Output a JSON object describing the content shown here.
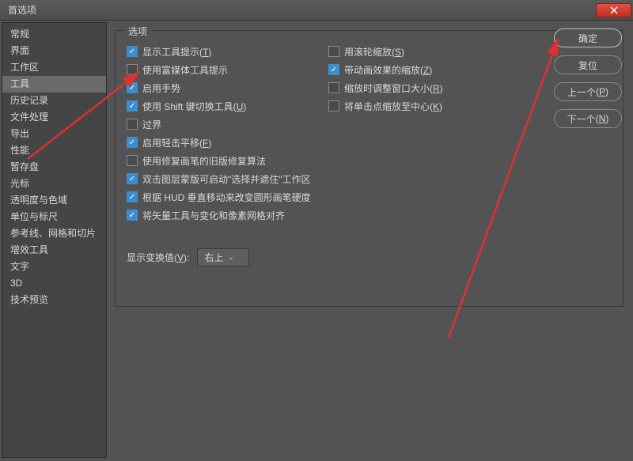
{
  "window": {
    "title": "首选项"
  },
  "sidebar": {
    "items": [
      {
        "label": "常规"
      },
      {
        "label": "界面"
      },
      {
        "label": "工作区"
      },
      {
        "label": "工具",
        "active": true
      },
      {
        "label": "历史记录"
      },
      {
        "label": "文件处理"
      },
      {
        "label": "导出"
      },
      {
        "label": "性能"
      },
      {
        "label": "暂存盘"
      },
      {
        "label": "光标"
      },
      {
        "label": "透明度与色域"
      },
      {
        "label": "单位与标尺"
      },
      {
        "label": "参考线、网格和切片"
      },
      {
        "label": "增效工具"
      },
      {
        "label": "文字"
      },
      {
        "label": "3D"
      },
      {
        "label": "技术预览"
      }
    ]
  },
  "group": {
    "title": "选项"
  },
  "opts_left": [
    {
      "label": "显示工具提示",
      "key": "T",
      "checked": true
    },
    {
      "label": "使用富媒体工具提示",
      "key": "",
      "checked": false
    },
    {
      "label": "启用手势",
      "key": "",
      "checked": true
    },
    {
      "label": "使用 Shift 键切换工具",
      "key": "U",
      "checked": true
    },
    {
      "label": "过界",
      "key": "",
      "checked": false
    },
    {
      "label": "启用轻击平移",
      "key": "F",
      "checked": true
    },
    {
      "label": "使用修复画笔的旧版修复算法",
      "key": "",
      "checked": false
    },
    {
      "label": "双击图层蒙版可启动\"选择并遮住\"工作区",
      "key": "",
      "checked": true
    },
    {
      "label": "根据 HUD 垂直移动来改变圆形画笔硬度",
      "key": "",
      "checked": true
    },
    {
      "label": "将矢量工具与变化和像素网格对齐",
      "key": "",
      "checked": true
    }
  ],
  "opts_right": [
    {
      "label": "用滚轮缩放",
      "key": "S",
      "checked": false
    },
    {
      "label": "带动画效果的缩放",
      "key": "Z",
      "checked": true
    },
    {
      "label": "缩放时调整窗口大小",
      "key": "R",
      "checked": false
    },
    {
      "label": "将单击点缩放至中心",
      "key": "K",
      "checked": false
    }
  ],
  "show_transform": {
    "label": "显示变换值",
    "key": "V",
    "value": "右上"
  },
  "buttons": {
    "ok": "确定",
    "reset": "复位",
    "prev": "上一个",
    "prev_key": "P",
    "next": "下一个",
    "next_key": "N"
  }
}
